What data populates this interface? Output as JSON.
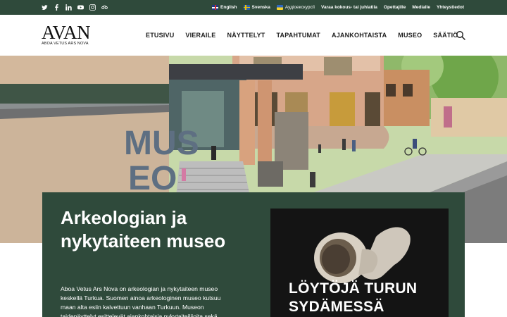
{
  "topbar": {
    "social": [
      "twitter-icon",
      "facebook-icon",
      "linkedin-icon",
      "youtube-icon",
      "instagram-icon",
      "tripadvisor-icon"
    ],
    "links": {
      "english": "English",
      "svenska": "Svenska",
      "audio": "Аудіоекскурсії",
      "venue": "Varaa kokous- tai juhlatila",
      "teachers": "Opettajille",
      "media": "Medialle",
      "contact": "Yhteystiedot"
    }
  },
  "header": {
    "logo_mark": "AVAN",
    "logo_sub": "ABOA VETUS ARS NOVA",
    "nav": {
      "home": "ETUSIVU",
      "visitor": "VIERAILE",
      "exhibitions": "NÄYTTELYT",
      "events": "TAPAHTUMAT",
      "news": "AJANKOHTAISTA",
      "museum": "MUSEO",
      "foundation": "SÄÄTIÖ"
    }
  },
  "hero": {
    "sign": [
      "MUS",
      "EO"
    ]
  },
  "main": {
    "title": "Arkeologian ja nykytaiteen museo",
    "description": "Aboa Vetus Ars Nova on arkeologian ja nykytaiteen museo keskellä Turkua. Suomen ainoa arkeologinen museo kutsuu maan alta esiin kaivettuun vanhaan Turkuun. Museon taidenäyttelyt esittelevät ajankohtaisia nykytaiteilijoita sekä",
    "promo_text": "LÖYTÖJÄ TURUN SYDÄMESSÄ"
  },
  "colors": {
    "brand_green": "#2f4a3b",
    "text_dark": "#1d1d1d"
  }
}
